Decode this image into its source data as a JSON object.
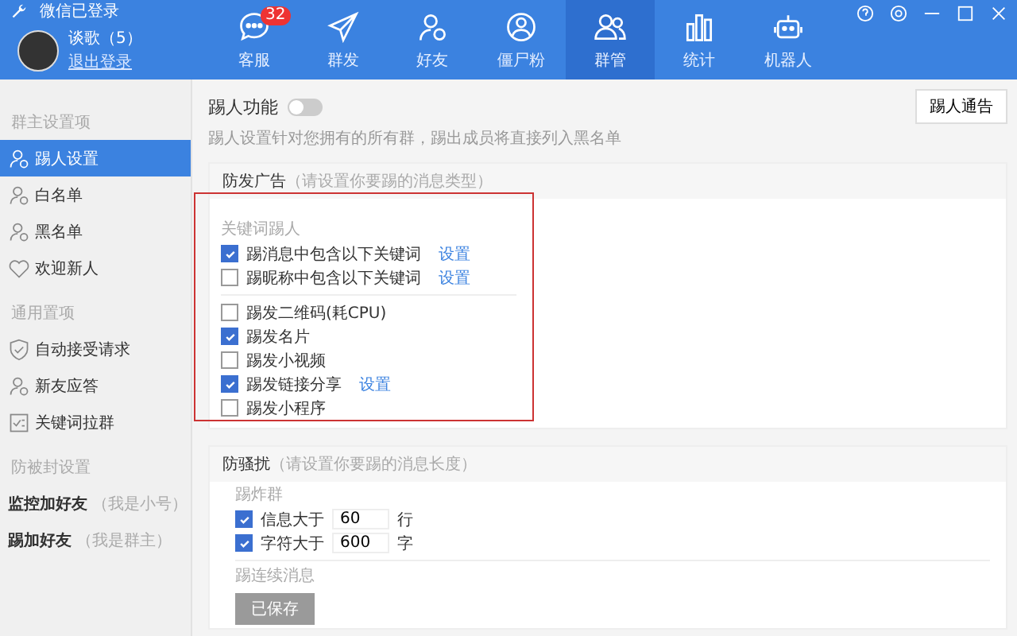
{
  "window": {
    "title": "微信已登录"
  },
  "user": {
    "name": "谈歌（5）",
    "logout": "退出登录"
  },
  "nav": [
    {
      "label": "客服",
      "badge": "32",
      "selected": false
    },
    {
      "label": "群发",
      "selected": false
    },
    {
      "label": "好友",
      "selected": false
    },
    {
      "label": "僵尸粉",
      "selected": false
    },
    {
      "label": "群管",
      "selected": true
    },
    {
      "label": "统计",
      "selected": false
    },
    {
      "label": "机器人",
      "selected": false
    }
  ],
  "sidebar": {
    "sections": [
      {
        "title": "群主设置项",
        "items": [
          {
            "label": "踢人设置",
            "selected": true
          },
          {
            "label": "白名单",
            "selected": false
          },
          {
            "label": "黑名单",
            "selected": false
          },
          {
            "label": "欢迎新人",
            "selected": false
          }
        ]
      },
      {
        "title": "通用置项",
        "items": [
          {
            "label": "自动接受请求",
            "selected": false
          },
          {
            "label": "新友应答",
            "selected": false
          },
          {
            "label": "关键词拉群",
            "selected": false
          }
        ]
      },
      {
        "title": "防被封设置",
        "items": [
          {
            "label": "监控加好友",
            "note": "（我是小号）",
            "selected": false
          },
          {
            "label": "踢加好友",
            "note": "（我是群主）",
            "selected": false
          }
        ]
      }
    ]
  },
  "kick": {
    "label": "踢人功能",
    "on": false,
    "description": "踢人设置针对您拥有的所有群，踢出成员将直接列入黑名单",
    "notice_button": "踢人通告"
  },
  "cards": [
    {
      "title": "防发广告",
      "hint": "（请设置你要踢的消息类型）",
      "highlighted": true,
      "groups": [
        {
          "title": "关键词踢人",
          "items": [
            {
              "kind": "checkbox",
              "label": "踢消息中包含以下关键词",
              "checked": true,
              "link": "设置"
            },
            {
              "kind": "checkbox",
              "label": "踢昵称中包含以下关键词",
              "checked": false,
              "link": "设置"
            }
          ]
        },
        {
          "items": [
            {
              "kind": "checkbox",
              "label": "踢发二维码(耗CPU)",
              "checked": false
            },
            {
              "kind": "checkbox",
              "label": "踢发名片",
              "checked": true
            },
            {
              "kind": "checkbox",
              "label": "踢发小视频",
              "checked": false
            },
            {
              "kind": "checkbox",
              "label": "踢发链接分享",
              "checked": true,
              "link": "设置"
            },
            {
              "kind": "checkbox",
              "label": "踢发小程序",
              "checked": false
            }
          ]
        }
      ]
    },
    {
      "title": "防骚扰",
      "hint": "（请设置你要踢的消息长度）",
      "highlighted": false,
      "groups": [
        {
          "title": "踢炸群",
          "items": [
            {
              "kind": "threshold",
              "label": "信息大于",
              "checked": true,
              "value": "60",
              "unit": "行"
            },
            {
              "kind": "threshold",
              "label": "字符大于",
              "checked": true,
              "value": "600",
              "unit": "字"
            }
          ]
        },
        {
          "title": "踢连续消息"
        }
      ],
      "save_button": {
        "label": "已保存",
        "disabled": true
      }
    }
  ]
}
